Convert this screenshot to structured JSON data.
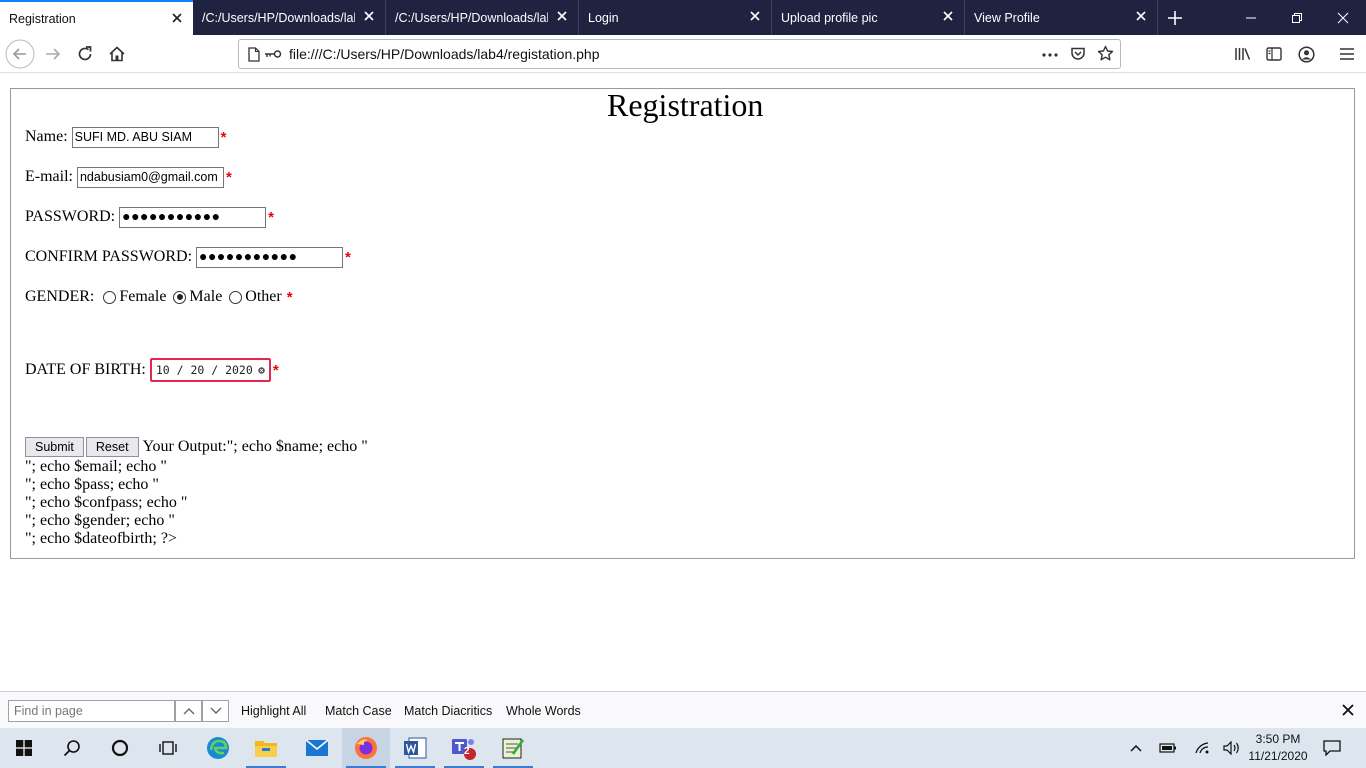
{
  "browser": {
    "tabs": [
      {
        "title": "Registration",
        "active": true
      },
      {
        "title": "/C:/Users/HP/Downloads/lab",
        "active": false
      },
      {
        "title": "/C:/Users/HP/Downloads/lab",
        "active": false
      },
      {
        "title": "Login",
        "active": false
      },
      {
        "title": "Upload profile pic",
        "active": false
      },
      {
        "title": "View Profile",
        "active": false
      }
    ],
    "url": "file:///C:/Users/HP/Downloads/lab4/registation.php",
    "accent_color": "#0a84ff",
    "tabstrip_color": "#202340"
  },
  "form": {
    "legend": "Registration",
    "name_label": "Name:",
    "name_value": "SUFI MD. ABU SIAM",
    "email_label": "E-mail:",
    "email_value": "ndabusiam0@gmail.com",
    "password_label": "PASSWORD:",
    "password_mask": "●●●●●●●●●●●",
    "confirm_label": "CONFIRM PASSWORD:",
    "confirm_mask": "●●●●●●●●●●●",
    "gender_label": "GENDER:",
    "gender_options": [
      "Female",
      "Male",
      "Other"
    ],
    "gender_selected": "Male",
    "dob_label": "DATE OF BIRTH:",
    "dob_value": "10 / 20 / 2020",
    "required_mark": "*",
    "submit_label": "Submit",
    "reset_label": "Reset",
    "output_lines": [
      "Your Output:\"; echo $name; echo \"",
      "\"; echo $email; echo \"",
      "\"; echo $pass; echo \"",
      "\"; echo $confpass; echo \"",
      "\"; echo $gender; echo \"",
      "\"; echo $dateofbirth; ?>"
    ]
  },
  "findbar": {
    "placeholder": "Find in page",
    "highlight_all": "Highlight All",
    "match_case": "Match Case",
    "match_diacritics": "Match Diacritics",
    "whole_words": "Whole Words"
  },
  "taskbar": {
    "time": "3:50 PM",
    "date": "11/21/2020",
    "teams_badge": "2"
  }
}
